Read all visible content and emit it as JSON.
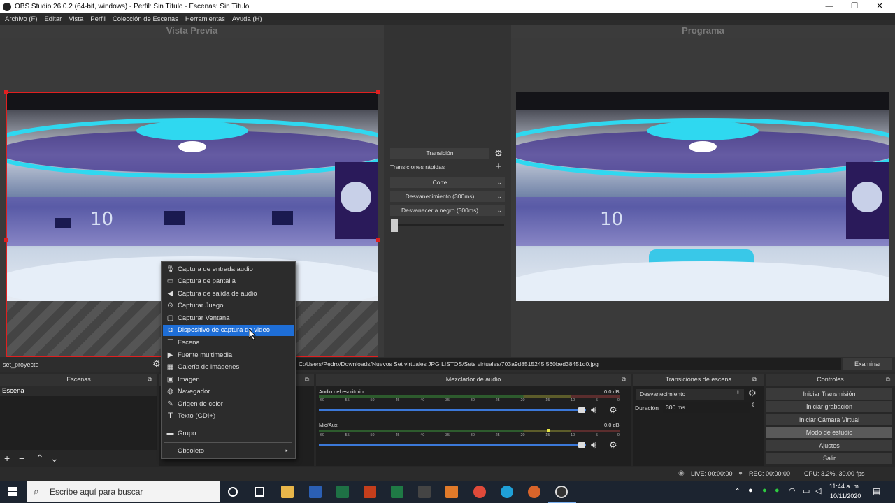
{
  "window": {
    "title": "OBS Studio 26.0.2 (64-bit, windows) - Perfil: Sin Título - Escenas: Sin Título",
    "minimize": "—",
    "maximize": "❐",
    "close": "✕"
  },
  "menubar": [
    "Archivo (F)",
    "Editar",
    "Vista",
    "Perfil",
    "Colección de Escenas",
    "Herramientas",
    "Ayuda (H)"
  ],
  "preview": {
    "title": "Vista Previa"
  },
  "program": {
    "title": "Programa"
  },
  "transition_panel": {
    "transition_button": "Transición",
    "quick_transitions_label": "Transiciones rápidas",
    "items": [
      "Corte",
      "Desvanecimiento (300ms)",
      "Desvanecer a negro (300ms)"
    ]
  },
  "source_bar": {
    "source_name": "set_proyecto",
    "file_path": "C:/Users/Pedro/Downloads/Nuevos Set virtuales JPG LISTOS/Sets virtuales/703a9d8515245.560bed38451d0.jpg",
    "browse_button": "Examinar"
  },
  "context_menu": {
    "items": [
      {
        "label": "Captura de entrada audio",
        "icon": "mic-icon"
      },
      {
        "label": "Captura de pantalla",
        "icon": "monitor-icon"
      },
      {
        "label": "Captura de salida de audio",
        "icon": "speaker-icon"
      },
      {
        "label": "Capturar Juego",
        "icon": "gamepad-icon"
      },
      {
        "label": "Capturar Ventana",
        "icon": "window-icon"
      },
      {
        "label": "Dispositivo de captura de video",
        "icon": "camera-icon"
      },
      {
        "label": "Escena",
        "icon": "list-icon"
      },
      {
        "label": "Fuente multimedia",
        "icon": "play-icon"
      },
      {
        "label": "Galería de imágenes",
        "icon": "gallery-icon"
      },
      {
        "label": "Imagen",
        "icon": "image-icon"
      },
      {
        "label": "Navegador",
        "icon": "globe-icon"
      },
      {
        "label": "Origen de color",
        "icon": "brush-icon"
      },
      {
        "label": "Texto (GDI+)",
        "icon": "text-icon"
      },
      {
        "label": "Grupo",
        "icon": "folder-icon"
      },
      {
        "label": "Obsoleto",
        "icon": "chevron-right-icon"
      }
    ],
    "selected_index": 5
  },
  "docks": {
    "scenes": {
      "title": "Escenas",
      "items": [
        "Escena"
      ]
    },
    "mixer": {
      "title": "Mezclador de audio",
      "channels": [
        {
          "name": "Audio del escritorio",
          "db": "0.0 dB",
          "level": 0.0
        },
        {
          "name": "Mic/Aux",
          "db": "0.0 dB",
          "level": 0.76
        }
      ],
      "ticks": [
        "-60",
        "-55",
        "-50",
        "-45",
        "-40",
        "-35",
        "-30",
        "-25",
        "-20",
        "-15",
        "-10",
        "-5",
        "0"
      ]
    },
    "transitions": {
      "title": "Transiciones de escena",
      "selected": "Desvanecimiento",
      "duration_label": "Duración",
      "duration_value": "300 ms"
    },
    "controls": {
      "title": "Controles",
      "buttons": [
        "Iniciar Transmisión",
        "Iniciar grabación",
        "Iniciar Cámara Virtual",
        "Modo de estudio",
        "Ajustes",
        "Salir"
      ],
      "active_index": 3
    }
  },
  "status": {
    "live": "LIVE: 00:00:00",
    "rec": "REC: 00:00:00",
    "cpu": "CPU: 3.2%, 30.00 fps"
  },
  "taskbar": {
    "search_placeholder": "Escribe aquí para buscar",
    "time": "11:44 a. m.",
    "date": "10/11/2020"
  }
}
